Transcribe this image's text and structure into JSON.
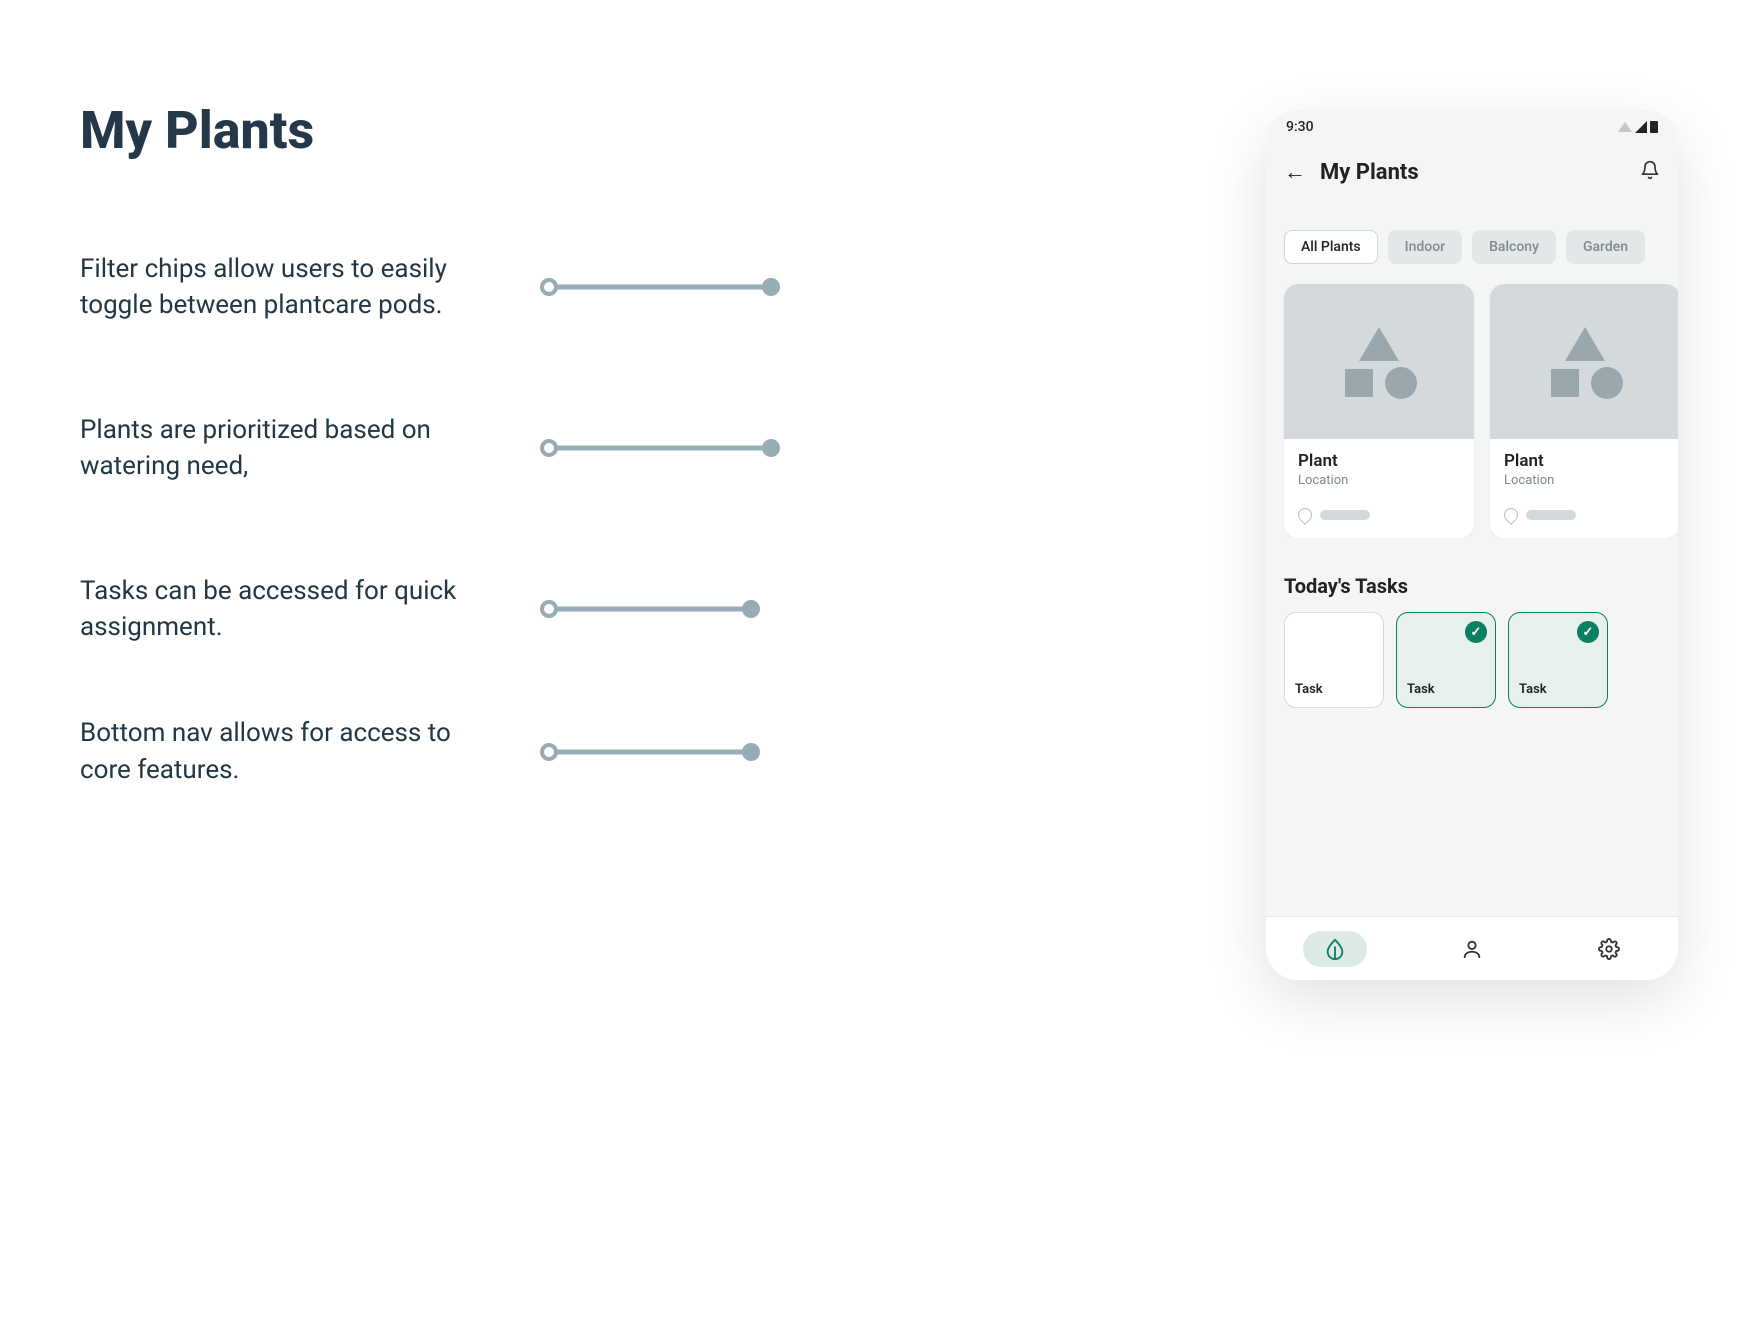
{
  "headline": "My Plants",
  "features": [
    "Filter chips allow users to easily toggle between plantcare pods.",
    "Plants are prioritized based on watering need,",
    "Tasks can be accessed for quick assignment.",
    "Bottom nav allows for access to core features."
  ],
  "phone": {
    "status_time": "9:30",
    "app_title": "My Plants",
    "chips": [
      {
        "label": "All Plants",
        "active": true
      },
      {
        "label": "Indoor",
        "active": false
      },
      {
        "label": "Balcony",
        "active": false
      },
      {
        "label": "Garden",
        "active": false
      }
    ],
    "plants": [
      {
        "title": "Plant",
        "subtitle": "Location"
      },
      {
        "title": "Plant",
        "subtitle": "Location"
      }
    ],
    "tasks_header": "Today's Tasks",
    "tasks": [
      {
        "label": "Task",
        "done": false
      },
      {
        "label": "Task",
        "done": true
      },
      {
        "label": "Task",
        "done": true
      }
    ],
    "bottom_nav": [
      {
        "name": "plants",
        "active": true
      },
      {
        "name": "profile",
        "active": false
      },
      {
        "name": "settings",
        "active": false
      }
    ]
  },
  "colors": {
    "accent": "#0d7f63",
    "muted": "#97adb6",
    "bg": "#f4f6f5"
  }
}
